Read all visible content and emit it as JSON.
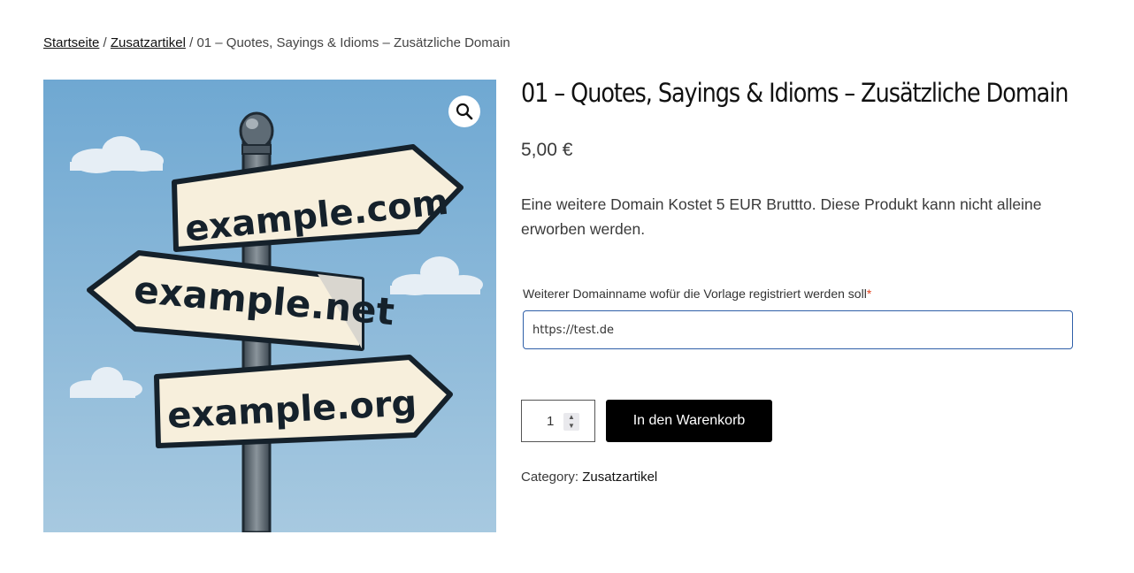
{
  "breadcrumb": {
    "home": "Startseite",
    "separator": " / ",
    "category": "Zusatzartikel",
    "current": "01 – Quotes, Sayings & Idioms – Zusätzliche Domain"
  },
  "product": {
    "title": "01 – Quotes, Sayings & Idioms – Zusätzliche Domain",
    "price": "5,00 €",
    "description": "Eine weitere Domain Kostet 5 EUR Bruttto. Diese Produkt kann nicht alleine erworben werden.",
    "image": {
      "signs": [
        "example.com",
        "example.net",
        "example.org"
      ],
      "sky_color": "#7bafd6"
    }
  },
  "domain_field": {
    "label": "Weiterer Domainname wofür die Vorlage registriert werden soll",
    "required_marker": "*",
    "value": "https://test.de"
  },
  "cart": {
    "quantity": "1",
    "button_label": "In den Warenkorb"
  },
  "meta": {
    "category_label": "Category:",
    "category_value": "Zusatzartikel"
  },
  "icons": {
    "zoom": "magnifier-icon",
    "spinner_up": "chevron-up-icon",
    "spinner_down": "chevron-down-icon"
  }
}
